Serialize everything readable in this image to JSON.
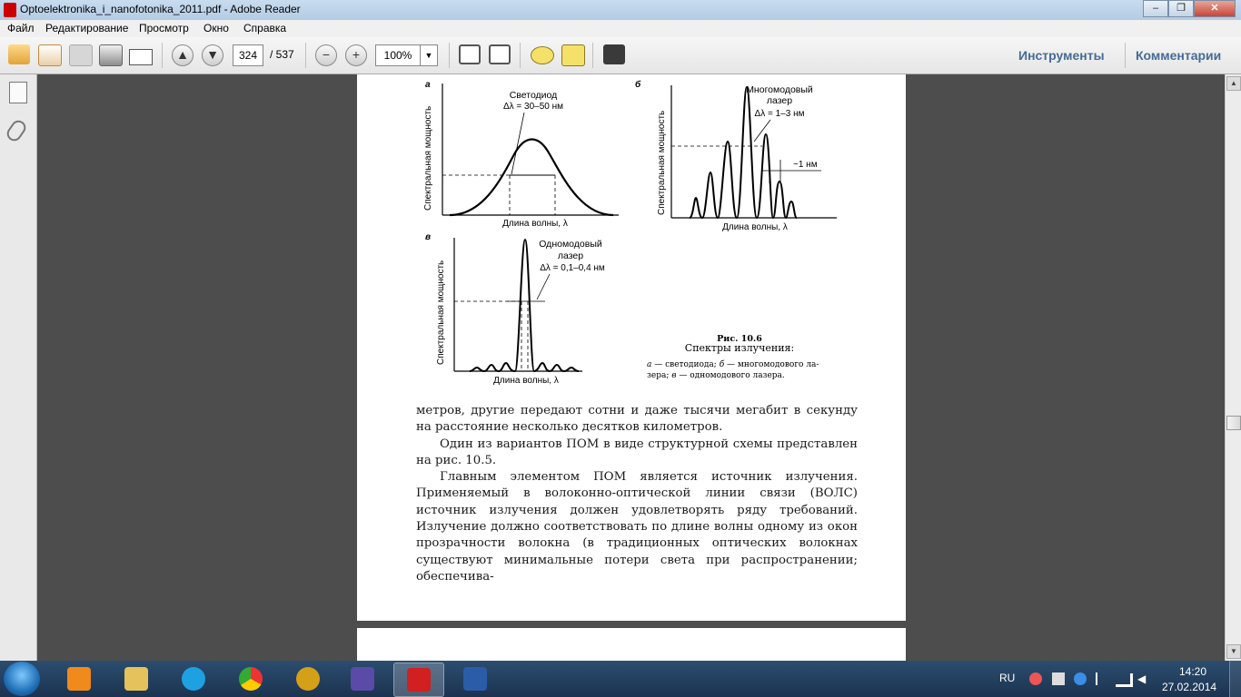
{
  "window": {
    "title": "Optoelektronika_i_nanofotonika_2011.pdf - Adobe Reader",
    "min": "‒",
    "max": "❐",
    "close": "✕"
  },
  "menu": [
    "Файл",
    "Редактирование",
    "Просмотр",
    "Окно",
    "Справка"
  ],
  "toolbar": {
    "page_current": "324",
    "page_total": "/ 537",
    "zoom": "100%",
    "tools_label": "Инструменты",
    "comments_label": "Комментарии"
  },
  "figure": {
    "a": {
      "letter": "а",
      "title": "Светодиод",
      "width": "Δλ = 30–50 нм",
      "ylabel": "Спектральная мощность",
      "xlabel": "Длина волны, λ"
    },
    "b": {
      "letter": "б",
      "title1": "Многомодовый",
      "title2": "лазер",
      "width": "Δλ = 1–3 нм",
      "spacing": "~1 нм",
      "ylabel": "Спектральная мощность",
      "xlabel": "Длина волны, λ"
    },
    "c": {
      "letter": "в",
      "title1": "Одномодовый",
      "title2": "лазер",
      "width": "Δλ = 0,1–0,4 нм",
      "ylabel": "Спектральная мощность",
      "xlabel": "Длина волны, λ"
    },
    "caption_num": "Рис. 10.6",
    "caption_title": "Спектры излучения:",
    "caption_l1_a": "а",
    "caption_l1_t1": " — светодиода; ",
    "caption_l1_b": "б",
    "caption_l1_t2": " — многомодового ла-",
    "caption_l2_t1": "зера; ",
    "caption_l2_c": "в",
    "caption_l2_t2": " — одномодового лазера."
  },
  "text": {
    "p1": "метров, другие передают сотни и даже тысячи мегабит в секунду на расстояние несколько десятков километров.",
    "p2": "Один из вариантов ПОМ в виде структурной схемы представлен на рис. 10.5.",
    "p3": "Главным элементом ПОМ является источник излучения. Применяемый в волоконно-оптической линии связи (ВОЛС) источник излучения должен удовлетворять ряду требований. Излучение должно соответствовать по длине волны одному из окон прозрачности волокна (в традиционных оптических волокнах существуют минимальные потери света при распространении; обеспечива-"
  },
  "taskbar": {
    "lang": "RU",
    "time": "14:20",
    "date": "27.02.2014"
  },
  "colors": {
    "taskbar": "#1c3350",
    "accent_link": "#466b95"
  }
}
